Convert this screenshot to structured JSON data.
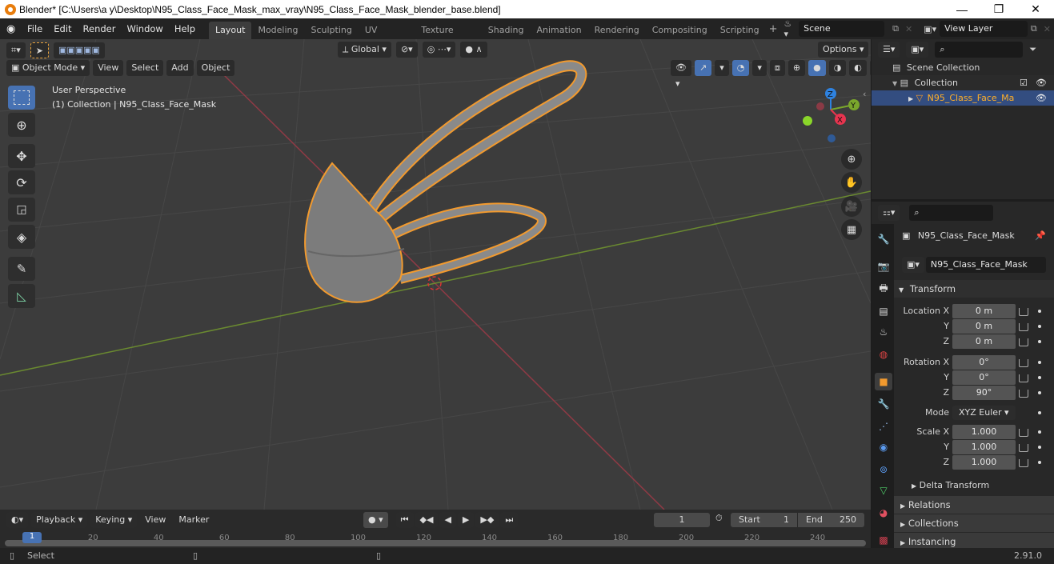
{
  "window": {
    "title": "Blender* [C:\\Users\\a y\\Desktop\\N95_Class_Face_Mask_max_vray\\N95_Class_Face_Mask_blender_base.blend]",
    "controls": {
      "minimize": "—",
      "maximize": "❐",
      "close": "✕"
    }
  },
  "menu": [
    "File",
    "Edit",
    "Render",
    "Window",
    "Help"
  ],
  "workspaces": [
    "Layout",
    "Modeling",
    "Sculpting",
    "UV Editing",
    "Texture Paint",
    "Shading",
    "Animation",
    "Rendering",
    "Compositing",
    "Scripting"
  ],
  "active_workspace": "Layout",
  "add_workspace": "+",
  "scene": {
    "name": "Scene"
  },
  "view_layer": {
    "name": "View Layer"
  },
  "viewport": {
    "transform_orientation": "Global",
    "options_label": "Options",
    "mode": "Object Mode",
    "header_menus": [
      "View",
      "Select",
      "Add",
      "Object"
    ],
    "overlay_line1": "User Perspective",
    "overlay_line2": "(1) Collection | N95_Class_Face_Mask",
    "gizmo_axes": {
      "x": "X",
      "y": "Y",
      "z": "Z"
    },
    "colors": {
      "x_axis": "#e8344f",
      "y_axis": "#7aa62c",
      "z_axis": "#2e82e0",
      "outline": "#f29a2e",
      "active_tool": "#4772b3"
    }
  },
  "outliner": {
    "search_placeholder": "",
    "items": [
      {
        "label": "Scene Collection",
        "level": 0
      },
      {
        "label": "Collection",
        "level": 1
      },
      {
        "label": "N95_Class_Face_Ma",
        "level": 2,
        "selected": true
      }
    ]
  },
  "properties": {
    "object_name": "N95_Class_Face_Mask",
    "datablock_name": "N95_Class_Face_Mask",
    "transform_label": "Transform",
    "location": {
      "label": "Location X",
      "x": "0 m",
      "y": "0 m",
      "z": "0 m"
    },
    "rotation": {
      "label": "Rotation X",
      "x": "0°",
      "y": "0°",
      "z": "90°"
    },
    "mode_label": "Mode",
    "mode_value": "XYZ Euler",
    "scale": {
      "label": "Scale X",
      "x": "1.000",
      "y": "1.000",
      "z": "1.000"
    },
    "axis_labels": {
      "y": "Y",
      "z": "Z"
    },
    "panels": [
      "Delta Transform",
      "Relations",
      "Collections",
      "Instancing"
    ]
  },
  "timeline": {
    "menus": [
      "Playback",
      "Keying",
      "View",
      "Marker"
    ],
    "current_frame": "1",
    "start_label": "Start",
    "start": "1",
    "end_label": "End",
    "end": "250",
    "ticks": [
      "1",
      "20",
      "40",
      "60",
      "80",
      "100",
      "120",
      "140",
      "160",
      "180",
      "200",
      "220",
      "240"
    ]
  },
  "status": {
    "select": "Select",
    "version": "2.91.0"
  }
}
